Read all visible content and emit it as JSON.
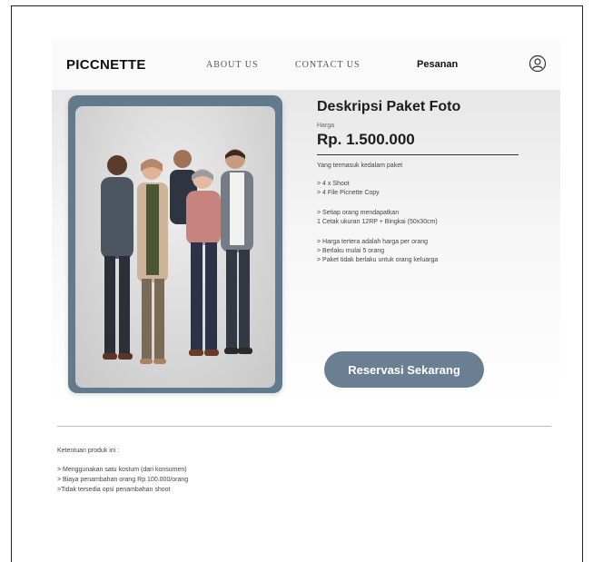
{
  "nav": {
    "brand": "PICCNETTE",
    "about": "ABOUT US",
    "contact": "CONTACT US",
    "order": "Pesanan",
    "user_icon": "user-icon"
  },
  "package": {
    "title": "Deskripsi Paket Foto",
    "price_label": "Harga",
    "price": "Rp. 1.500.000",
    "included_label": "Yang termasuk kedalam paket",
    "group1": [
      "> 4 x Shoot",
      "> 4 File Picnette Copy"
    ],
    "group2": [
      "> Setiap orang mendapatkan",
      "  1 Cetak ukuran 12RP + Bingkai (50x30cm)"
    ],
    "group3": [
      "> Harga tertera adalah harga per orang",
      "> Berlaku mulai 5 orang",
      "> Paket tidak berlaku untuk orang keluarga"
    ],
    "reserve_button": "Reservasi Sekarang",
    "photo_icon": "family-photo"
  },
  "terms": {
    "title": "Ketentuan produk ini :",
    "items": [
      "> Menggunakan satu kostum (dari   konsumen)",
      "> Biaya penambahan orang Rp 100.000/orang",
      ">Tidak tersedia opsi penambahan shoot"
    ]
  },
  "colors": {
    "accent": "#6b7f92",
    "photo_bg": "#63798c"
  }
}
